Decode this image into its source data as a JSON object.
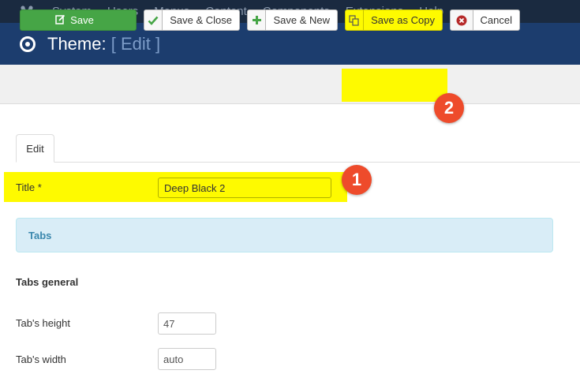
{
  "menu": {
    "items": [
      "System",
      "Users",
      "Menus",
      "Content",
      "Components",
      "Extensions",
      "Help"
    ]
  },
  "header": {
    "title": "Theme:",
    "subtitle": "[ Edit ]"
  },
  "toolbar": {
    "save_label": "Save",
    "save_close_label": "Save & Close",
    "save_new_label": "Save & New",
    "save_copy_label": "Save as Copy",
    "cancel_label": "Cancel"
  },
  "annotations": {
    "step1": "1",
    "step2": "2",
    "highlight_color": "#fefa00",
    "badge_color": "#ee4b2b"
  },
  "tabs": {
    "active": "Edit"
  },
  "form": {
    "title_label": "Title *",
    "title_value": "Deep Black 2",
    "panel_title": "Tabs",
    "section_heading": "Tabs general",
    "tab_height_label": "Tab's height",
    "tab_height_value": "47",
    "tab_width_label": "Tab's width",
    "tab_width_value": "auto"
  },
  "colors": {
    "topbar": "#1a2a40",
    "header": "#1c3d6e",
    "save_button": "#46a546",
    "info_panel": "#d9edf7"
  }
}
